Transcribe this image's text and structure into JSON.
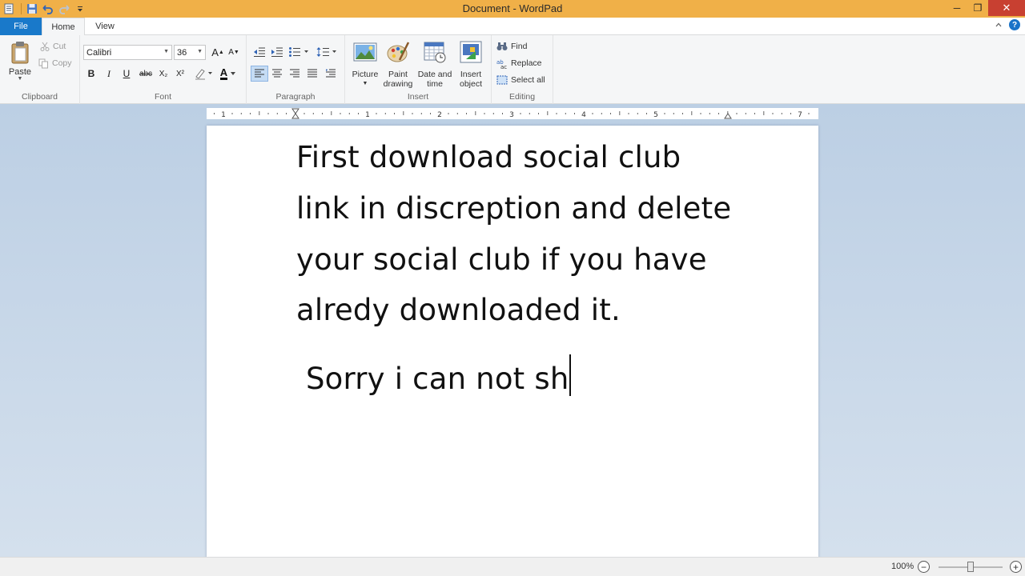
{
  "window": {
    "title": "Document - WordPad",
    "minimize_glyph": "─",
    "restore_glyph": "❐",
    "close_glyph": "✕"
  },
  "tabs": [
    {
      "label": "File",
      "selected": false
    },
    {
      "label": "Home",
      "selected": true
    },
    {
      "label": "View",
      "selected": false
    }
  ],
  "ribbon": {
    "clipboard": {
      "label": "Clipboard",
      "paste": "Paste",
      "cut": "Cut",
      "copy": "Copy"
    },
    "font": {
      "label": "Font",
      "font_name": "Calibri",
      "font_size": "36",
      "bold": "B",
      "italic": "I",
      "underline": "U",
      "strikethrough": "abc",
      "subscript": "X₂",
      "superscript": "X²",
      "text_color": "A"
    },
    "paragraph": {
      "label": "Paragraph",
      "alignment": "left"
    },
    "insert": {
      "label": "Insert",
      "picture": "Picture",
      "paint_line1": "Paint",
      "paint_line2": "drawing",
      "date_line1": "Date and",
      "date_line2": "time",
      "object_line1": "Insert",
      "object_line2": "object"
    },
    "editing": {
      "label": "Editing",
      "find": "Find",
      "replace": "Replace",
      "select_all": "Select all"
    }
  },
  "ruler": {
    "numbers": [
      "1",
      "1",
      "2",
      "3",
      "4",
      "5",
      "7"
    ]
  },
  "document": {
    "lines": [
      "First download social club",
      "link in discreption and delete",
      "your social club if you have",
      "alredy downloaded it.",
      " Sorry i can not sh"
    ]
  },
  "statusbar": {
    "zoom": "100%",
    "zoom_level": 0.5
  },
  "colors": {
    "titlebar": "#f0b048",
    "file_tab": "#1979ca",
    "close_button": "#c84031",
    "workspace": "#bccfe4"
  }
}
